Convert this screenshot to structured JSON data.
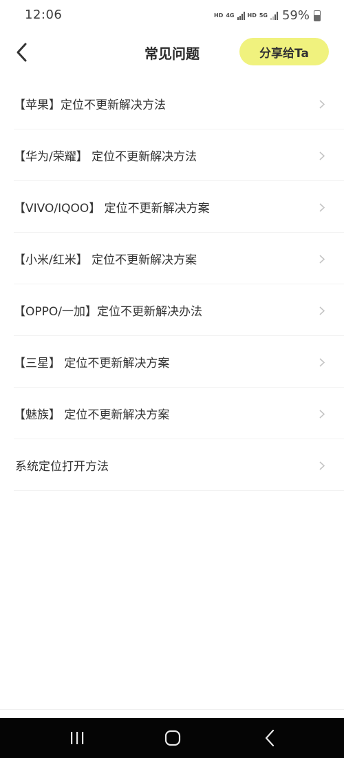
{
  "status_bar": {
    "time": "12:06",
    "net1": "HD",
    "net2": "4G",
    "net3": "HD",
    "net4": "5G",
    "battery": "59%"
  },
  "header": {
    "title": "常见问题",
    "share_label": "分享给Ta",
    "share_color": "#f0f27e"
  },
  "faq": [
    {
      "label": "【苹果】定位不更新解决方法"
    },
    {
      "label": "【华为/荣耀】 定位不更新解决方法"
    },
    {
      "label": "【VIVO/IQOO】 定位不更新解决方案"
    },
    {
      "label": "【小米/红米】 定位不更新解决方案"
    },
    {
      "label": "【OPPO/一加】定位不更新解决办法"
    },
    {
      "label": "【三星】 定位不更新解决方案"
    },
    {
      "label": "【魅族】 定位不更新解决方案"
    },
    {
      "label": "系统定位打开方法"
    }
  ],
  "nav": {
    "recents_icon": "recents-icon",
    "home_icon": "home-icon",
    "back_icon": "back-icon"
  }
}
